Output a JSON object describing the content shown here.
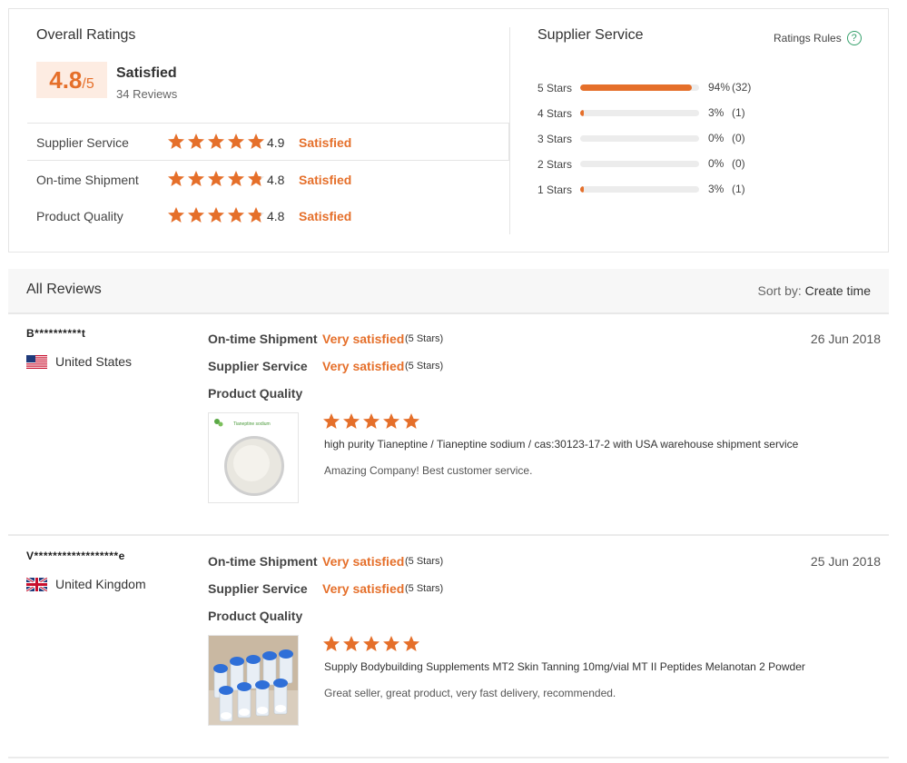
{
  "overall": {
    "title": "Overall Ratings",
    "score": "4.8",
    "score_of": "/5",
    "label": "Satisfied",
    "review_count": "34 Reviews"
  },
  "metrics": [
    {
      "label": "Supplier Service",
      "score": "4.9",
      "word": "Satisfied",
      "stars": 5
    },
    {
      "label": "On-time Shipment",
      "score": "4.8",
      "word": "Satisfied",
      "stars": 4.8
    },
    {
      "label": "Product Quality",
      "score": "4.8",
      "word": "Satisfied",
      "stars": 4.8
    }
  ],
  "supplier": {
    "title": "Supplier Service",
    "rules_label": "Ratings Rules",
    "distribution": [
      {
        "label": "5 Stars",
        "percent": "94%",
        "count": "(32)",
        "fraction": 0.94
      },
      {
        "label": "4 Stars",
        "percent": "3%",
        "count": "(1)",
        "fraction": 0.03
      },
      {
        "label": "3 Stars",
        "percent": "0%",
        "count": "(0)",
        "fraction": 0
      },
      {
        "label": "2 Stars",
        "percent": "0%",
        "count": "(0)",
        "fraction": 0
      },
      {
        "label": "1 Stars",
        "percent": "3%",
        "count": "(1)",
        "fraction": 0.03
      }
    ]
  },
  "reviews_header": {
    "title": "All Reviews",
    "sort_label": "Sort by:",
    "sort_value": "Create time"
  },
  "reviews": [
    {
      "user": "B**********t",
      "country": "United States",
      "date": "26 Jun 2018",
      "shipment_label": "On-time Shipment",
      "shipment_value": "Very satisfied",
      "shipment_stars": "(5 Stars)",
      "service_label": "Supplier Service",
      "service_value": "Very satisfied",
      "service_stars": "(5 Stars)",
      "quality_label": "Product Quality",
      "product_stars": 5,
      "product": "high purity Tianeptine / Tianeptine sodium / cas:30123-17-2 with USA warehouse shipment service",
      "comment": "Amazing Company! Best customer service.",
      "thumb_caption": "Tianeptine sodium"
    },
    {
      "user": "V******************e",
      "country": "United Kingdom",
      "date": "25 Jun 2018",
      "shipment_label": "On-time Shipment",
      "shipment_value": "Very satisfied",
      "shipment_stars": "(5 Stars)",
      "service_label": "Supplier Service",
      "service_value": "Very satisfied",
      "service_stars": "(5 Stars)",
      "quality_label": "Product Quality",
      "product_stars": 5,
      "product": "Supply Bodybuilding Supplements MT2 Skin Tanning 10mg/vial MT II Peptides Melanotan 2 Powder",
      "comment": "Great seller, great product, very fast delivery, recommended."
    }
  ],
  "colors": {
    "accent": "#e56f2a",
    "score_bg": "#fdece2",
    "help": "#35a06b",
    "vial_cap": "#2f6fd8"
  },
  "icons": [
    "star-icon",
    "help-icon",
    "us-flag-icon",
    "uk-flag-icon"
  ]
}
